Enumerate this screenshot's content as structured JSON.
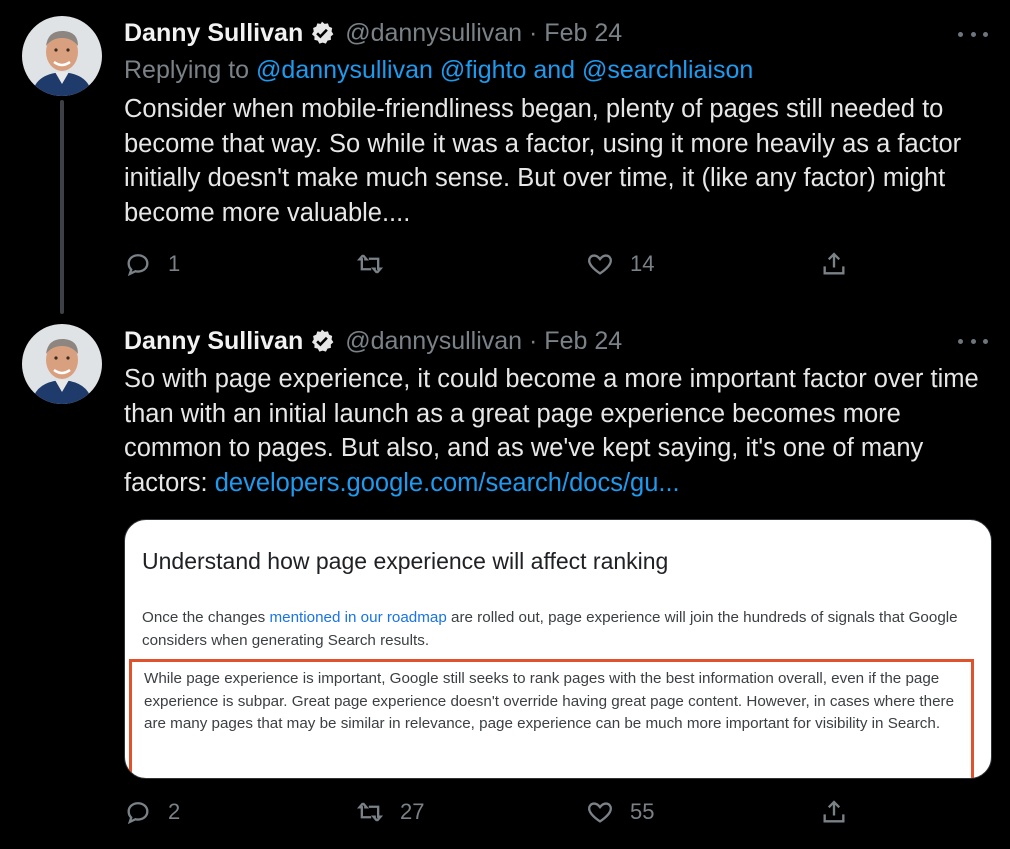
{
  "tweet1": {
    "name": "Danny Sullivan",
    "handle": "@dannysullivan · Feb 24",
    "replying_prefix": "Replying to ",
    "replying_to": "@dannysullivan @fighto and @searchliaison",
    "text": "Consider when mobile-friendliness began, plenty of pages still needed to become that way. So while it was a factor, using it more heavily as a factor initially doesn't make much sense. But over time, it (like any factor) might become more valuable....",
    "reply_count": "1",
    "retweet_count": "",
    "like_count": "14"
  },
  "tweet2": {
    "name": "Danny Sullivan",
    "handle": "@dannysullivan · Feb 24",
    "text": "So with page experience, it could become a more important factor over time than with an initial launch as a great page experience becomes more common to pages. But also, and as we've kept saying, it's one of many factors: ",
    "link": "developers.google.com/search/docs/gu...",
    "reply_count": "2",
    "retweet_count": "27",
    "like_count": "55",
    "card": {
      "title": "Understand how page experience will affect ranking",
      "p1_before": "Once the changes ",
      "p1_link": "mentioned in our roadmap",
      "p1_after": " are rolled out, page experience will join the hundreds of signals that Google considers when generating Search results.",
      "highlight": "While page experience is important, Google still seeks to rank pages with the best information overall, even if the page experience is subpar. Great page experience doesn't override having great page content. However, in cases where there are many pages that may be similar in relevance, page experience can be much more important for visibility in Search."
    }
  },
  "colors": {
    "background": "#000000",
    "link": "#1d9bf0",
    "muted": "#7a8288",
    "highlight_border": "#e0522c"
  }
}
